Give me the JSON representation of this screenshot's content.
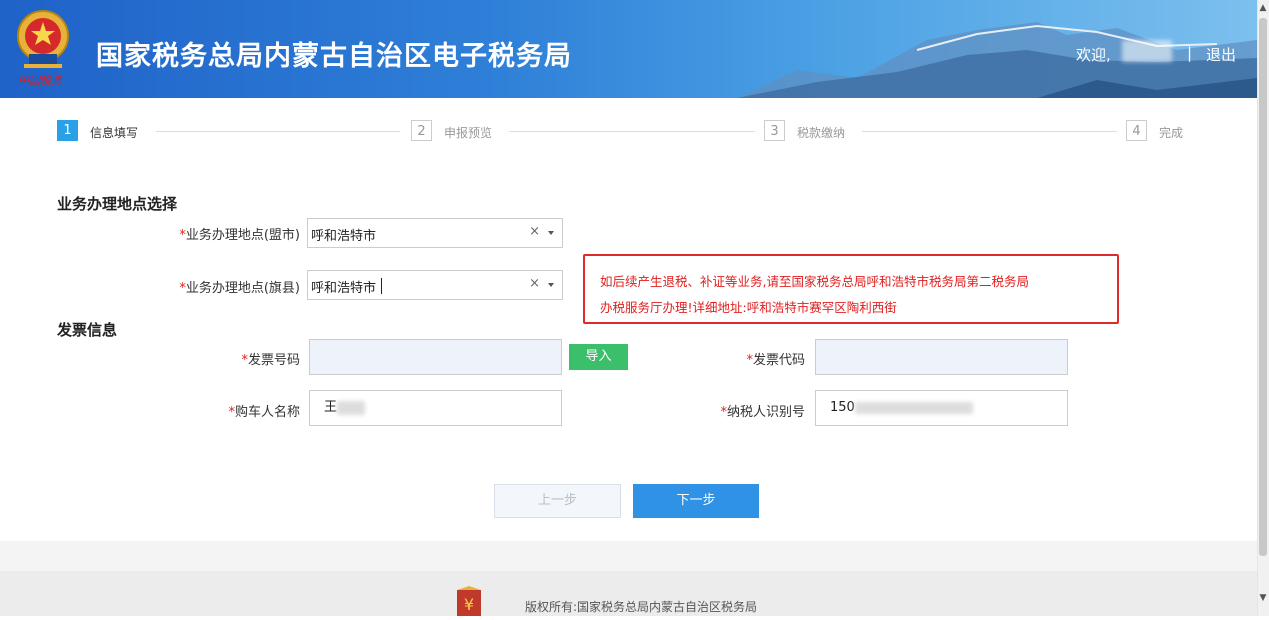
{
  "header": {
    "title": "国家税务总局内蒙古自治区电子税务局",
    "welcome": "欢迎,",
    "separator": "|",
    "logout": "退出",
    "emblem_caption": "中国税务"
  },
  "steps": [
    {
      "num": "1",
      "label": "信息填写",
      "active": true
    },
    {
      "num": "2",
      "label": "申报预览",
      "active": false
    },
    {
      "num": "3",
      "label": "税款缴纳",
      "active": false
    },
    {
      "num": "4",
      "label": "完成",
      "active": false
    }
  ],
  "location": {
    "section_title": "业务办理地点选择",
    "required_mark": "*",
    "league_label": "业务办理地点(盟市)",
    "league_value": "呼和浩特市",
    "county_label": "业务办理地点(旗县)",
    "county_value": "呼和浩特市",
    "clear_symbol": "×"
  },
  "notice": {
    "line1": "如后续产生退税、补证等业务,请至国家税务总局呼和浩特市税务局第二税务局",
    "line2": "办税服务厅办理!详细地址:呼和浩特市赛罕区陶利西街"
  },
  "invoice": {
    "section_title": "发票信息",
    "number_label": "发票号码",
    "number_value": "",
    "import_label": "导入",
    "code_label": "发票代码",
    "code_value": "",
    "buyer_label": "购车人名称",
    "buyer_value": "王",
    "taxid_label": "纳税人识别号",
    "taxid_value": "150"
  },
  "buttons": {
    "prev": "上一步",
    "next": "下一步"
  },
  "footer": {
    "copyright": "版权所有:国家税务总局内蒙古自治区税务局"
  },
  "colors": {
    "accent": "#2aa0e6",
    "header_blue": "#1f62c8",
    "import_green": "#3cbf6b",
    "notice_red": "#e02020",
    "next_blue": "#2f92e5"
  }
}
